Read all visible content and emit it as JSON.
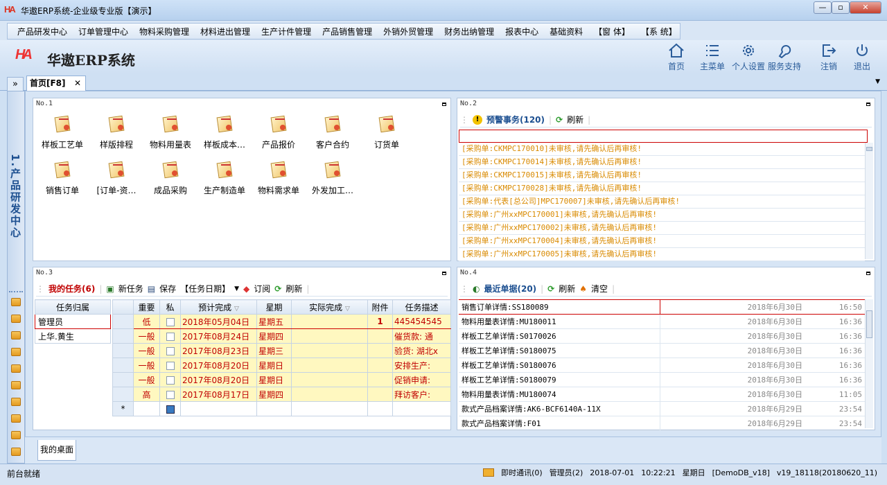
{
  "window": {
    "title": "华遨ERP系统-企业级专业版【演示】",
    "logo": "HA"
  },
  "menu": [
    "产品研发中心",
    "订单管理中心",
    "物料采购管理",
    "材料进出管理",
    "生产计件管理",
    "产品销售管理",
    "外销外贸管理",
    "财务出纳管理",
    "报表中心",
    "基础资料",
    "【窗 体】",
    "【系 统】"
  ],
  "header": {
    "brand": "华遨ERP系统",
    "toolbar": [
      {
        "label": "首页",
        "icon": "home-icon"
      },
      {
        "label": "主菜单",
        "icon": "list-icon"
      },
      {
        "label": "个人设置",
        "icon": "gear-icon"
      },
      {
        "label": "服务支持",
        "icon": "support-icon"
      },
      {
        "label": "注销",
        "icon": "logout-icon"
      },
      {
        "label": "退出",
        "icon": "power-icon"
      }
    ]
  },
  "tabs": {
    "home": "首页[F8]",
    "close": "✕",
    "expand": "»",
    "dropdown": "▼"
  },
  "sidebar": {
    "title": "1.产品研发中心"
  },
  "panel1": {
    "num": "No.1",
    "icons": [
      "样板工艺单",
      "样版排程",
      "物料用量表",
      "样板成本…",
      "产品报价",
      "客户合约",
      "订货单",
      "销售订单",
      "[订单-资…",
      "成品采购",
      "生产制造单",
      "物料需求单",
      "外发加工…"
    ]
  },
  "panel2": {
    "num": "No.2",
    "warning_label": "预警事务(120)",
    "refresh": "刷新",
    "items": [
      "[采购单:CKMPC170010]未审核,请先确认后再审核!",
      "[采购单:CKMPC170014]未审核,请先确认后再审核!",
      "[采购单:CKMPC170015]未审核,请先确认后再审核!",
      "[采购单:CKMPC170028]未审核,请先确认后再审核!",
      "[采购单:代表[总公司]MPC170007]未审核,请先确认后再审核!",
      "[采购单:广州xxMPC170001]未审核,请先确认后再审核!",
      "[采购单:广州xxMPC170002]未审核,请先确认后再审核!",
      "[采购单:广州xxMPC170004]未审核,请先确认后再审核!",
      "[采购单:广州xxMPC170005]未审核,请先确认后再审核!"
    ]
  },
  "panel3": {
    "num": "No.3",
    "toolbar": {
      "my_tasks": "我的任务(6)",
      "new": "新任务",
      "save": "保存",
      "date": "【任务日期】",
      "subscribe": "订阅",
      "refresh": "刷新"
    },
    "owner_header": "任务归属",
    "owners": [
      "管理员",
      "上华.黄生"
    ],
    "columns": [
      "重要",
      "私",
      "预计完成",
      "星期",
      "实际完成",
      "附件",
      "任务描述"
    ],
    "rows": [
      {
        "imp": "低",
        "due": "2018年05月04日",
        "week": "星期五",
        "actual": "",
        "att": "1",
        "desc": "445454545"
      },
      {
        "imp": "一般",
        "due": "2017年08月24日",
        "week": "星期四",
        "actual": "",
        "att": "",
        "desc": "催货款: 通"
      },
      {
        "imp": "一般",
        "due": "2017年08月23日",
        "week": "星期三",
        "actual": "",
        "att": "",
        "desc": "验货: 湖北x"
      },
      {
        "imp": "一般",
        "due": "2017年08月20日",
        "week": "星期日",
        "actual": "",
        "att": "",
        "desc": "安排生产:"
      },
      {
        "imp": "一般",
        "due": "2017年08月20日",
        "week": "星期日",
        "actual": "",
        "att": "",
        "desc": "促销申请:"
      },
      {
        "imp": "高",
        "due": "2017年08月17日",
        "week": "星期四",
        "actual": "",
        "att": "",
        "desc": "拜访客户:"
      }
    ],
    "new_row": "*"
  },
  "panel4": {
    "num": "No.4",
    "toolbar": {
      "recent": "最近单据(20)",
      "refresh": "刷新",
      "clear": "清空"
    },
    "rows": [
      {
        "doc": "销售订单详情:SS180089",
        "date": "2018年6月30日",
        "time": "16:50"
      },
      {
        "doc": "物料用量表详情:MU180011",
        "date": "2018年6月30日",
        "time": "16:36"
      },
      {
        "doc": "样板工艺单详情:S0170026",
        "date": "2018年6月30日",
        "time": "16:36"
      },
      {
        "doc": "样板工艺单详情:S0180075",
        "date": "2018年6月30日",
        "time": "16:36"
      },
      {
        "doc": "样板工艺单详情:S0180076",
        "date": "2018年6月30日",
        "time": "16:36"
      },
      {
        "doc": "样板工艺单详情:S0180079",
        "date": "2018年6月30日",
        "time": "16:36"
      },
      {
        "doc": "物料用量表详情:MU180074",
        "date": "2018年6月30日",
        "time": "11:05"
      },
      {
        "doc": "款式产品档案详情:AK6-BCF6140A-11X",
        "date": "2018年6月29日",
        "time": "23:54"
      },
      {
        "doc": "款式产品档案详情:F01",
        "date": "2018年6月29日",
        "time": "23:54"
      }
    ]
  },
  "bottom_tab": "我的桌面",
  "status": {
    "left": "前台就绪",
    "im": "即时通讯(0)",
    "user": "管理员(2)",
    "date": "2018-07-01",
    "time": "10:22:21",
    "weekday": "星期日",
    "db": "[DemoDB_v18]",
    "version": "v19_18118(20180620_11)"
  },
  "colors": {
    "accent": "#1c4f90",
    "warn": "#d98a00",
    "red": "#c00000",
    "rowbg": "#fff8c0"
  }
}
